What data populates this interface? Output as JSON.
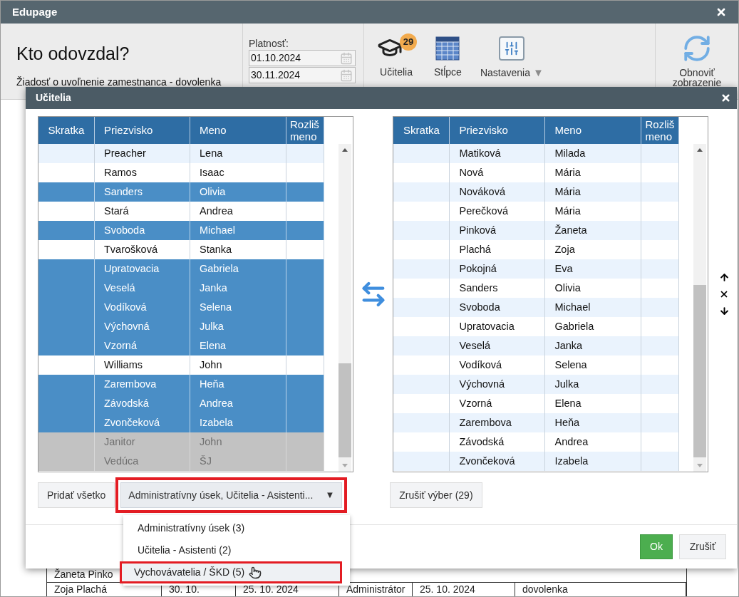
{
  "window": {
    "title": "Edupage"
  },
  "header": {
    "title": "Kto odovzdal?",
    "subtitle": "Žiadosť o uvoľnenie zamestnanca - dovolenka"
  },
  "validity": {
    "label": "Platnosť:",
    "from": "01.10.2024",
    "to": "30.11.2024"
  },
  "toolbar": [
    {
      "kind": "teachers",
      "label": "Učitelia",
      "badge": "29"
    },
    {
      "kind": "columns",
      "label": "Stĺpce"
    },
    {
      "kind": "settings",
      "label": "Nastavenia",
      "caret": "▼"
    }
  ],
  "refresh": {
    "label": "Obnoviť zobrazenie"
  },
  "background_table": {
    "rows": [
      [
        "Žaneta Pinko",
        "",
        "",
        "",
        "",
        ""
      ],
      [
        "Zoja Plachá",
        "30. 10.",
        "25. 10. 2024",
        "Administrátor",
        "25. 10. 2024",
        "dovolenka"
      ]
    ]
  },
  "dialog": {
    "title": "Učitelia",
    "left_table": {
      "columns": [
        "Skratka",
        "Priezvisko",
        "Meno",
        "Rozliš meno"
      ],
      "rows": [
        {
          "surname": "Preacher",
          "name": "Lena",
          "selected": false,
          "disabled": false
        },
        {
          "surname": "Ramos",
          "name": "Isaac",
          "selected": false,
          "disabled": false
        },
        {
          "surname": "Sanders",
          "name": "Olivia",
          "selected": true,
          "disabled": false
        },
        {
          "surname": "Stará",
          "name": "Andrea",
          "selected": false,
          "disabled": false
        },
        {
          "surname": "Svoboda",
          "name": "Michael",
          "selected": true,
          "disabled": false
        },
        {
          "surname": "Tvarošková",
          "name": "Stanka",
          "selected": false,
          "disabled": false
        },
        {
          "surname": "Upratovacia",
          "name": "Gabriela",
          "selected": true,
          "disabled": false
        },
        {
          "surname": "Veselá",
          "name": "Janka",
          "selected": true,
          "disabled": false
        },
        {
          "surname": "Vodíková",
          "name": "Selena",
          "selected": true,
          "disabled": false
        },
        {
          "surname": "Výchovná",
          "name": "Julka",
          "selected": true,
          "disabled": false
        },
        {
          "surname": "Vzorná",
          "name": "Elena",
          "selected": true,
          "disabled": false
        },
        {
          "surname": "Williams",
          "name": "John",
          "selected": false,
          "disabled": false
        },
        {
          "surname": "Zarembova",
          "name": "Heňa",
          "selected": true,
          "disabled": false
        },
        {
          "surname": "Závodská",
          "name": "Andrea",
          "selected": true,
          "disabled": false
        },
        {
          "surname": "Zvončeková",
          "name": "Izabela",
          "selected": true,
          "disabled": false
        },
        {
          "surname": "Janitor",
          "name": "John",
          "selected": false,
          "disabled": true
        },
        {
          "surname": "Vedúca",
          "name": "ŠJ",
          "selected": false,
          "disabled": true
        }
      ]
    },
    "right_table": {
      "columns": [
        "Skratka",
        "Priezvisko",
        "Meno",
        "Rozliš meno"
      ],
      "rows": [
        {
          "surname": "Matiková",
          "name": "Milada"
        },
        {
          "surname": "Nová",
          "name": "Mária"
        },
        {
          "surname": "Nováková",
          "name": "Mária"
        },
        {
          "surname": "Perečková",
          "name": "Mária"
        },
        {
          "surname": "Pinková",
          "name": "Žaneta"
        },
        {
          "surname": "Plachá",
          "name": "Zoja"
        },
        {
          "surname": "Pokojná",
          "name": "Eva"
        },
        {
          "surname": "Sanders",
          "name": "Olivia"
        },
        {
          "surname": "Svoboda",
          "name": "Michael"
        },
        {
          "surname": "Upratovacia",
          "name": "Gabriela"
        },
        {
          "surname": "Veselá",
          "name": "Janka"
        },
        {
          "surname": "Vodíková",
          "name": "Selena"
        },
        {
          "surname": "Výchovná",
          "name": "Julka"
        },
        {
          "surname": "Vzorná",
          "name": "Elena"
        },
        {
          "surname": "Zarembova",
          "name": "Heňa"
        },
        {
          "surname": "Závodská",
          "name": "Andrea"
        },
        {
          "surname": "Zvončeková",
          "name": "Izabela"
        }
      ]
    },
    "add_all": "Pridať všetko",
    "filter": {
      "value": "Administratívny úsek, Učitelia - Asistenti...",
      "caret": "▼",
      "expanded": true
    },
    "options": [
      {
        "label": "Administratívny úsek (3)",
        "selected": false
      },
      {
        "label": "Učitelia - Asistenti (2)",
        "selected": false
      },
      {
        "label": "Vychovávatelia / ŠKD (5)",
        "selected": true
      }
    ],
    "clear": "Zrušiť výber (29)",
    "ok": "Ok",
    "cancel": "Zrušiť"
  }
}
